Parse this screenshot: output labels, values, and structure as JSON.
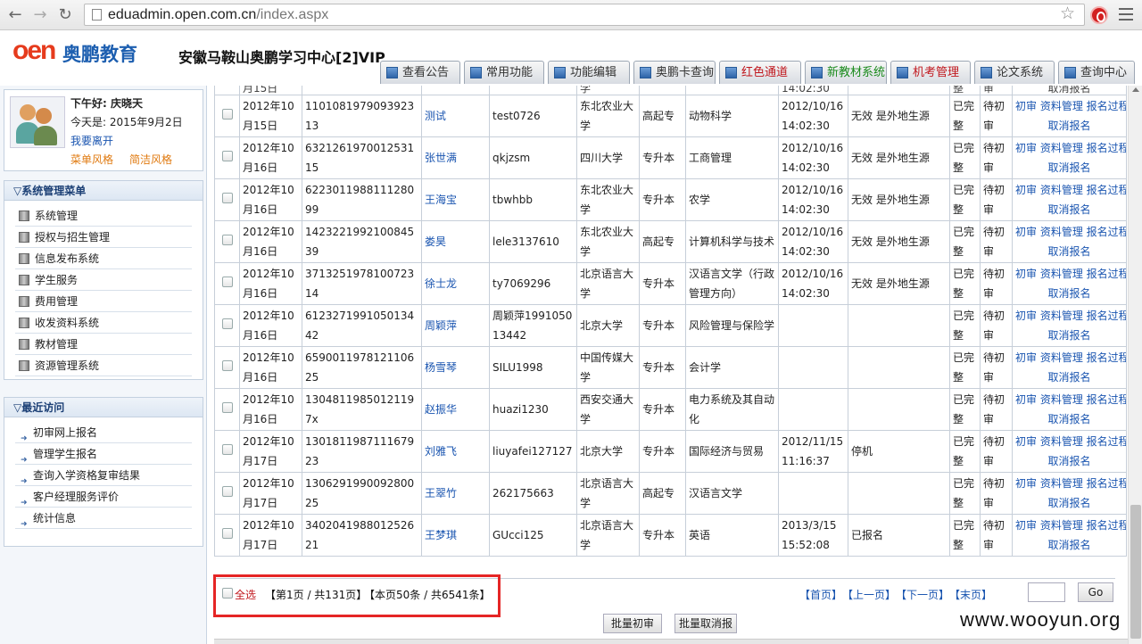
{
  "browser": {
    "url_host": "eduadmin.open.com.cn",
    "url_path": "/index.aspx"
  },
  "header": {
    "logo_mark": "oen",
    "logo_text": "奥鹏教育",
    "org_title": "安徽马鞍山奥鹏学习中心[2]VIP",
    "tabs": [
      {
        "label": "查看公告",
        "color": "#333333"
      },
      {
        "label": "常用功能",
        "color": "#333333"
      },
      {
        "label": "功能编辑",
        "color": "#333333"
      },
      {
        "label": "奥鹏卡查询",
        "color": "#333333"
      },
      {
        "label": "红色通道",
        "color": "#c0161c"
      },
      {
        "label": "新教材系统",
        "color": "#198a1b"
      },
      {
        "label": "机考管理",
        "color": "#c0161c"
      },
      {
        "label": "论文系统",
        "color": "#333333"
      },
      {
        "label": "查询中心",
        "color": "#333333"
      }
    ]
  },
  "user": {
    "greeting": "下午好: 庆晓天",
    "today": "今天是: 2015年9月2日",
    "leave_link": "我要离开",
    "menu_style": "菜单风格",
    "simple_style": "简洁风格"
  },
  "system_menu": {
    "title": "▽系统管理菜单",
    "items": [
      "系统管理",
      "授权与招生管理",
      "信息发布系统",
      "学生服务",
      "费用管理",
      "收发资料系统",
      "教材管理",
      "资源管理系统"
    ]
  },
  "recent": {
    "title": "▽最近访问",
    "items": [
      "初审网上报名",
      "管理学生报名",
      "查询入学资格复审结果",
      "客户经理服务评价",
      "统计信息"
    ]
  },
  "table": {
    "partial_row": [
      "月15日",
      "学",
      "14:02:30",
      "整",
      "审",
      "取消报名"
    ],
    "ops_line1": "初审 资料管理 报名过程",
    "ops_line2": "取消报名",
    "rows": [
      {
        "date": "2012年10月15日",
        "id": "110108197909392313",
        "name": "测试",
        "account": "test0726",
        "school": "东北农业大学",
        "level": "高起专",
        "major": "动物科学",
        "time": "2012/10/16 14:02:30",
        "status": "无效 是外地生源",
        "c1": "已完整",
        "c2": "待初审"
      },
      {
        "date": "2012年10月16日",
        "id": "632126197001253115",
        "name": "张世满",
        "account": "qkjzsm",
        "school": "四川大学",
        "level": "专升本",
        "major": "工商管理",
        "time": "2012/10/16 14:02:30",
        "status": "无效 是外地生源",
        "c1": "已完整",
        "c2": "待初审"
      },
      {
        "date": "2012年10月16日",
        "id": "622301198811128099",
        "name": "王海宝",
        "account": "tbwhbb",
        "school": "东北农业大学",
        "level": "专升本",
        "major": "农学",
        "time": "2012/10/16 14:02:30",
        "status": "无效 是外地生源",
        "c1": "已完整",
        "c2": "待初审"
      },
      {
        "date": "2012年10月16日",
        "id": "142322199210084539",
        "name": "娄昊",
        "account": "lele3137610",
        "school": "东北农业大学",
        "level": "高起专",
        "major": "计算机科学与技术",
        "time": "2012/10/16 14:02:30",
        "status": "无效 是外地生源",
        "c1": "已完整",
        "c2": "待初审"
      },
      {
        "date": "2012年10月16日",
        "id": "371325197810072314",
        "name": "徐士龙",
        "account": "ty7069296",
        "school": "北京语言大学",
        "level": "专升本",
        "major": "汉语言文学（行政管理方向）",
        "time": "2012/10/16 14:02:30",
        "status": "无效 是外地生源",
        "c1": "已完整",
        "c2": "待初审"
      },
      {
        "date": "2012年10月16日",
        "id": "612327199105013442",
        "name": "周颖萍",
        "account": "周颖萍199105013442",
        "school": "北京大学",
        "level": "专升本",
        "major": "风险管理与保险学",
        "time": "",
        "status": "",
        "c1": "已完整",
        "c2": "待初审"
      },
      {
        "date": "2012年10月16日",
        "id": "659001197812110625",
        "name": "杨雪琴",
        "account": "SILU1998",
        "school": "中国传媒大学",
        "level": "专升本",
        "major": "会计学",
        "time": "",
        "status": "",
        "c1": "已完整",
        "c2": "待初审"
      },
      {
        "date": "2012年10月16日",
        "id": "13048119850121197x",
        "name": "赵振华",
        "account": "huazi1230",
        "school": "西安交通大学",
        "level": "专升本",
        "major": "电力系统及其自动化",
        "time": "",
        "status": "",
        "c1": "已完整",
        "c2": "待初审"
      },
      {
        "date": "2012年10月17日",
        "id": "130181198711167923",
        "name": "刘雅飞",
        "account": "liuyafei127127",
        "school": "北京大学",
        "level": "专升本",
        "major": "国际经济与贸易",
        "time": "2012/11/15 11:16:37",
        "status": "停机",
        "c1": "已完整",
        "c2": "待初审"
      },
      {
        "date": "2012年10月17日",
        "id": "130629199009280025",
        "name": "王翠竹",
        "account": "262175663",
        "school": "北京语言大学",
        "level": "高起专",
        "major": "汉语言文学",
        "time": "",
        "status": "",
        "c1": "已完整",
        "c2": "待初审"
      },
      {
        "date": "2012年10月17日",
        "id": "340204198801252621",
        "name": "王梦琪",
        "account": "GUcci125",
        "school": "北京语言大学",
        "level": "专升本",
        "major": "英语",
        "time": "2013/3/15 15:52:08",
        "status": "已报名",
        "c1": "已完整",
        "c2": "待初审"
      }
    ]
  },
  "pager": {
    "select_all": "全选",
    "page_info": "【第1页 / 共131页】",
    "count_info": "【本页50条 / 共6541条】",
    "first": "【首页】",
    "prev": "【上一页】",
    "next": "【下一页】",
    "last": "【末页】",
    "go": "Go",
    "page_input": ""
  },
  "batch": {
    "approve": "批量初审",
    "cancel": "批量取消报"
  },
  "watermark": "www.wooyun.org",
  "colors": {
    "accent": "#1a55b0",
    "highlight": "#e52525"
  }
}
